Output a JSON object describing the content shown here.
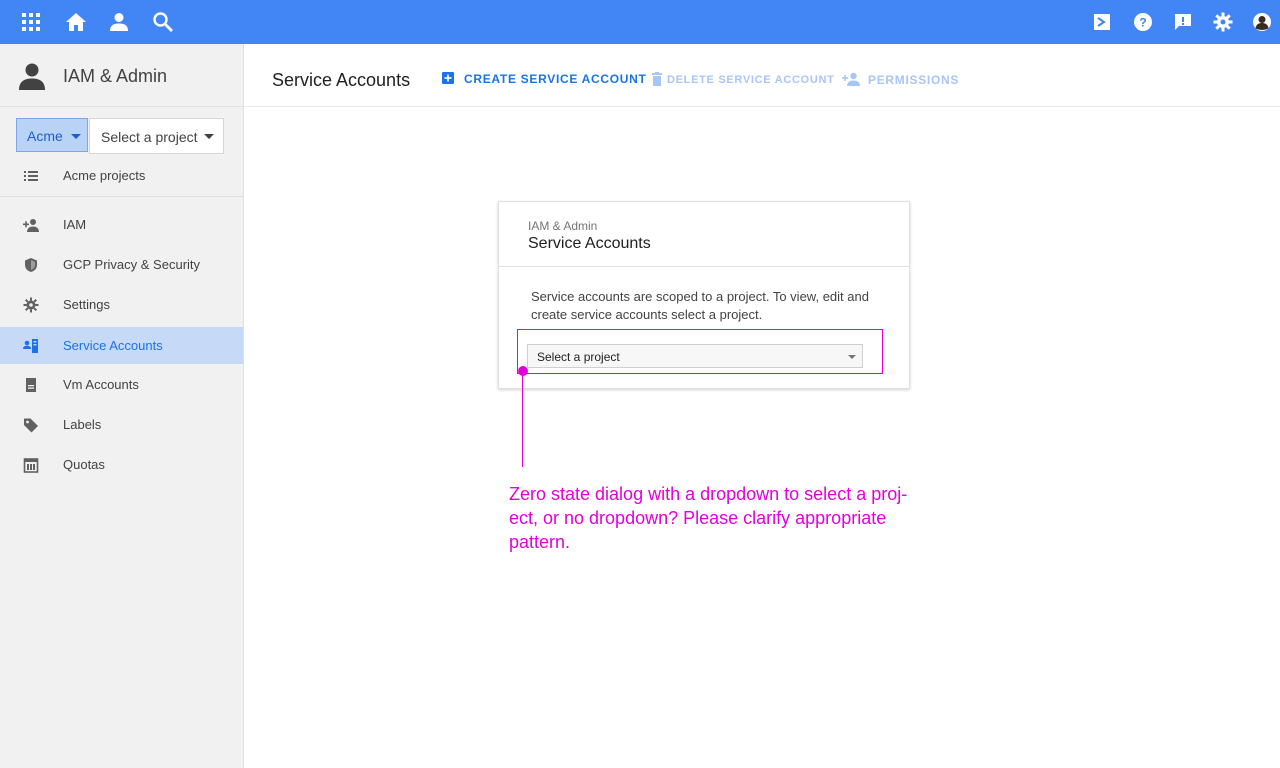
{
  "app": {
    "title": "IAM & Admin",
    "org_button": "Acme",
    "project_select": "Select a project"
  },
  "topbar": {
    "left_icons": [
      "apps-grid-icon",
      "home-icon",
      "person-icon",
      "search-icon"
    ],
    "right_icons": [
      "cloud-shell-icon",
      "help-icon",
      "feedback-icon",
      "settings-icon",
      "avatar"
    ]
  },
  "sidebar": {
    "projects_link": "Acme projects",
    "items": [
      {
        "label": "IAM",
        "icon": "person-add-icon",
        "active": false
      },
      {
        "label": "GCP Privacy & Security",
        "icon": "shield-icon",
        "active": false
      },
      {
        "label": "Settings",
        "icon": "gear-icon",
        "active": false
      },
      {
        "label": "Service Accounts",
        "icon": "service-account-icon",
        "active": true
      },
      {
        "label": "Vm Accounts",
        "icon": "document-icon",
        "active": false
      },
      {
        "label": "Labels",
        "icon": "tag-icon",
        "active": false
      },
      {
        "label": "Quotas",
        "icon": "calendar-icon",
        "active": false
      }
    ]
  },
  "main": {
    "title": "Service Accounts",
    "actions": {
      "create": "CREATE SERVICE ACCOUNT",
      "delete": "DELETE SERVICE ACCOUNT",
      "permissions": "PERMISSIONS"
    }
  },
  "dialog": {
    "subtitle": "IAM & Admin",
    "title": "Service Accounts",
    "body": "Service accounts are scoped to a project. To view, edit and create service accounts select a project.",
    "select_placeholder": "Select a project"
  },
  "annotation": {
    "text": "Zero state dialog with a dropdown to select a proj-ect, or no dropdown? Please clarify appropriate pattern.",
    "color": "#e400d9"
  },
  "colors": {
    "brand": "#4285f4",
    "accent": "#1a73e8",
    "disabled_action": "#a8c6f5"
  }
}
